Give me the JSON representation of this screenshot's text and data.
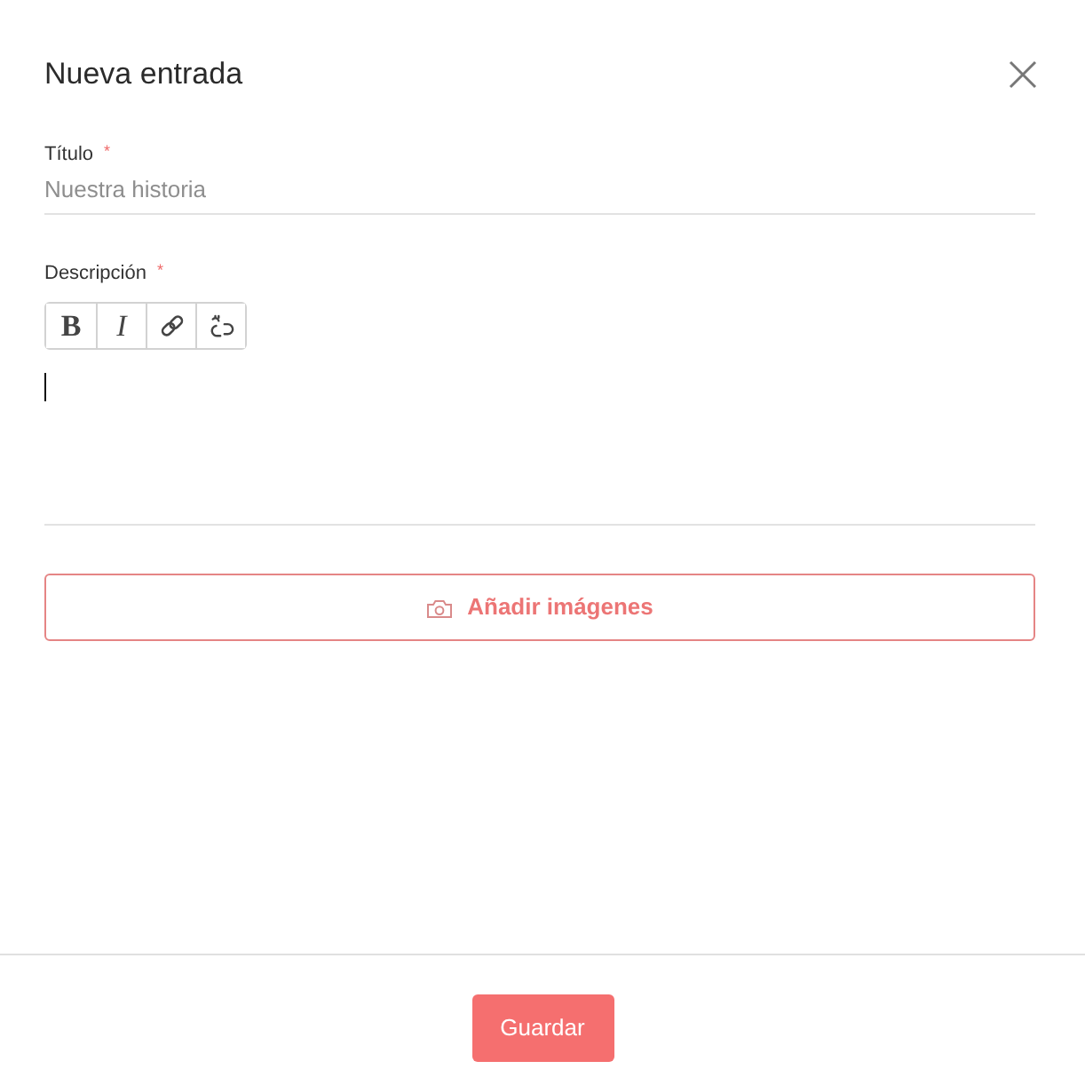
{
  "dialog": {
    "title": "Nueva entrada"
  },
  "fields": [
    {
      "kind": "text",
      "label": "Título",
      "required": true,
      "required_mark": "*",
      "placeholder": "Nuestra historia"
    },
    {
      "kind": "rich_text",
      "label": "Descripción",
      "required": true,
      "required_mark": "*",
      "focused": true,
      "toolbar": [
        {
          "kind": "bold",
          "label": "B"
        },
        {
          "kind": "italic",
          "label": "I"
        },
        {
          "kind": "link"
        },
        {
          "kind": "unlink"
        }
      ]
    }
  ],
  "add_images_button": {
    "label": "Añadir imágenes"
  },
  "footer": {
    "save_button": {
      "label": "Guardar"
    }
  }
}
